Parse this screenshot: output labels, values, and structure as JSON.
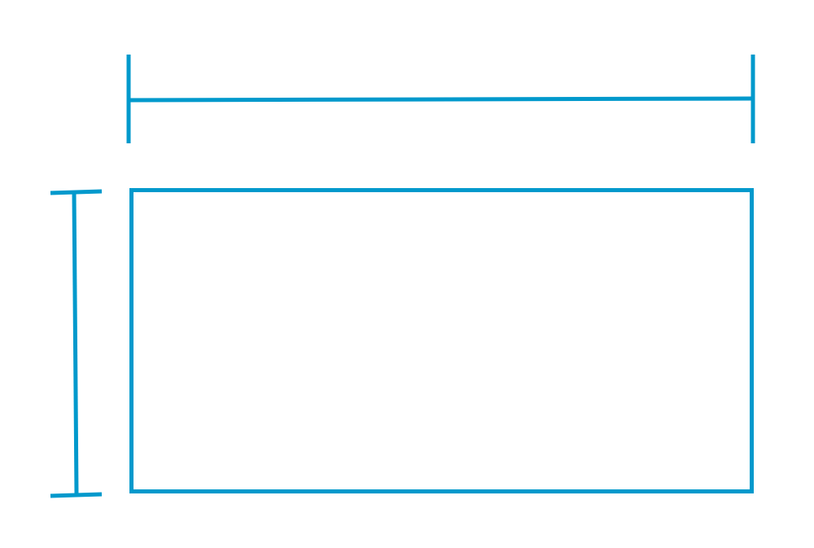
{
  "diagram": {
    "stroke_color": "#0099cc",
    "background_color": "#ffffff",
    "elements": [
      {
        "type": "width-dimension-line",
        "orientation": "horizontal"
      },
      {
        "type": "height-dimension-line",
        "orientation": "vertical"
      },
      {
        "type": "rectangle"
      }
    ]
  }
}
